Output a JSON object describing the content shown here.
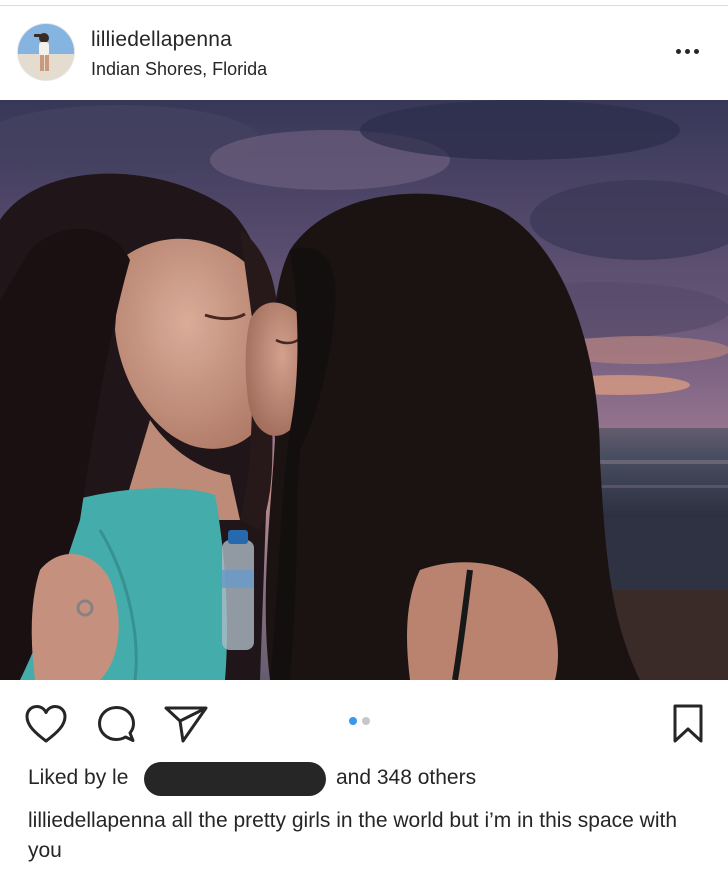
{
  "post": {
    "username": "lilliedellapenna",
    "location": "Indian Shores, Florida",
    "more_icon": "more-horizontal-icon"
  },
  "photo": {
    "description_icon": "post-photo",
    "colors": {
      "sky_top": "#39395a",
      "sky_mid": "#8a6f8f",
      "horizon": "#d9a08a",
      "sea": "#4a4f63",
      "sand": "#3a3e4d",
      "hair": "#1f1512",
      "skin": "#d8a58e",
      "shirt": "#45b5b4"
    }
  },
  "actions": {
    "like_icon": "heart-icon",
    "comment_icon": "comment-icon",
    "share_icon": "send-icon",
    "save_icon": "bookmark-icon",
    "carousel": {
      "count": 2,
      "active_index": 0
    },
    "accent_color": "#3897f0"
  },
  "likes": {
    "liked_by_prefix": "Liked by le",
    "others_text": "and 348 others"
  },
  "caption": {
    "username": "lilliedellapenna",
    "text": "all the pretty girls in the world but i’m in this space with you"
  }
}
